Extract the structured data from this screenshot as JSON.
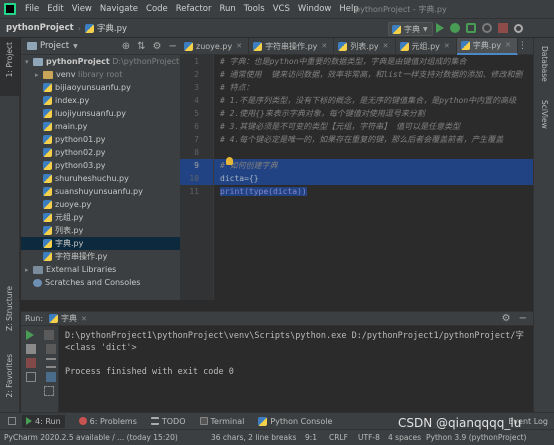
{
  "menubar": {
    "items": [
      "File",
      "Edit",
      "View",
      "Navigate",
      "Code",
      "Refactor",
      "Run",
      "Tools",
      "VCS",
      "Window",
      "Help"
    ],
    "window_title": "pythonProject - 字典.py"
  },
  "navbar": {
    "project": "pythonProject",
    "file": "字典.py",
    "run_config": "字典"
  },
  "project_panel": {
    "title": "Project",
    "root_name": "pythonProject",
    "root_path": "D:\\pythonProject1\\pytho",
    "venv_name": "venv",
    "venv_hint": "library root",
    "files": [
      "bijiaoyunsuanfu.py",
      "index.py",
      "luojiyunsuanfu.py",
      "main.py",
      "python01.py",
      "python02.py",
      "python03.py",
      "shuruheshuchu.py",
      "suanshuyunsuanfu.py",
      "zuoye.py",
      "元组.py",
      "列表.py",
      "字典.py",
      "字符串操作.py"
    ],
    "selected_file": "字典.py",
    "external_libraries": "External Libraries",
    "scratches": "Scratches and Consoles"
  },
  "editor": {
    "tabs": [
      "zuoye.py",
      "字符串操作.py",
      "列表.py",
      "元组.py",
      "字典.py"
    ],
    "active_tab": "字典.py",
    "lines": [
      "# 字典：也是python中重要的数据类型，字典是由键值对组成的集合",
      "# 通常使用  键来访问数据，效率非常高，和list一样支持对数据的添加、修改和删",
      "# 特点：",
      "# 1.不是序列类型，没有下标的概念，是无序的键值集合，是python中内置的高级",
      "# 2.使用{}来表示字典对象，每个键值对使用逗号来分割",
      "# 3.其键必须是不可变的类型【元组，字符串】 值可以是任意类型",
      "# 4.每个键必定是唯一的，如果存在重复的键，那么后者会覆盖前者，产生覆盖",
      "",
      "# 如何创建字典",
      "dicta={}",
      "print(type(dicta))"
    ]
  },
  "run_panel": {
    "label": "Run:",
    "config": "字典",
    "output": [
      "D:\\pythonProject1\\pythonProject\\venv\\Scripts\\python.exe D:/pythonProject1/pythonProject/字",
      "<class 'dict'>",
      "",
      "Process finished with exit code 0"
    ]
  },
  "side_tabs": {
    "left": [
      "1: Project",
      "Z: Structure",
      "2: Favorites"
    ],
    "right": [
      "Database",
      "SciView"
    ]
  },
  "bottom_tabs": [
    "4: Run",
    "6: Problems",
    "TODO",
    "Terminal",
    "Python Console",
    "Event Log"
  ],
  "status": {
    "message": "PyCharm 2020.2.5 available / ... (today 15:20)",
    "selection": "36 chars, 2 line breaks",
    "position": "9:1",
    "line_sep": "CRLF",
    "encoding": "UTF-8",
    "indent": "4 spaces",
    "interpreter": "Python 3.9 (pythonProject)"
  },
  "watermark": "CSDN @qianqqqq_lu",
  "colors": {
    "accent": "#4a88c7",
    "selection": "#214283",
    "run_green": "#499c54"
  }
}
